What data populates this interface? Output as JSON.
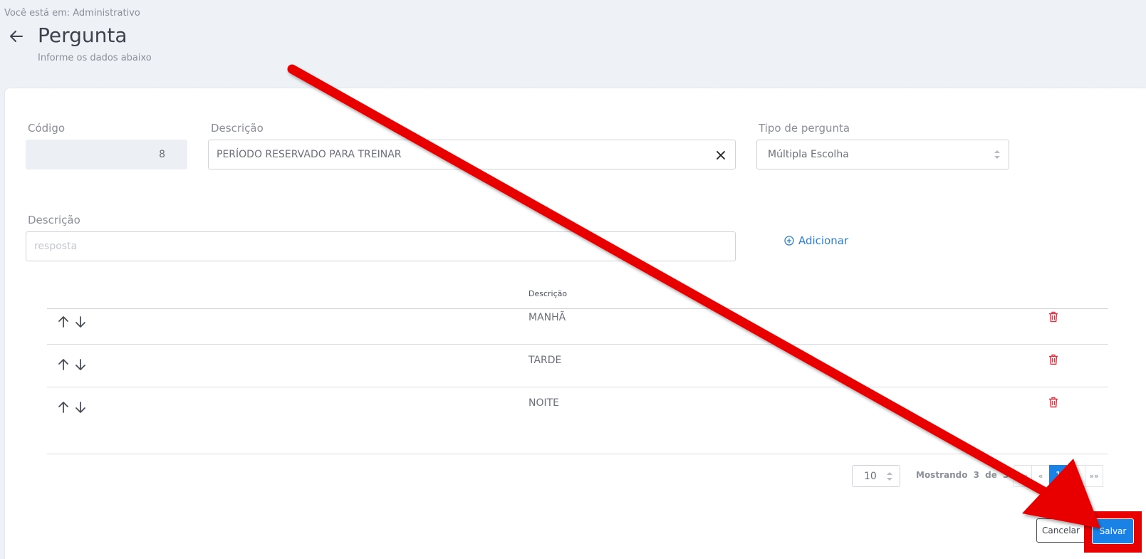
{
  "breadcrumb": "Você está em: Administrativo",
  "page": {
    "title": "Pergunta",
    "subtitle": "Informe os dados abaixo"
  },
  "form": {
    "codigo": {
      "label": "Código",
      "value": "8"
    },
    "descricao": {
      "label": "Descrição",
      "value": "PERÍODO RESERVADO PARA TREINAR"
    },
    "tipo": {
      "label": "Tipo de pergunta",
      "value": "Múltipla Escolha"
    },
    "resposta": {
      "label": "Descrição",
      "placeholder": "resposta"
    },
    "add_label": "Adicionar"
  },
  "table": {
    "header": "Descrição",
    "rows": [
      "MANHÃ",
      "TARDE",
      "NOITE"
    ]
  },
  "pagination": {
    "page_size": "10",
    "showing": "Mostrando 3 de 3",
    "first": "««",
    "prev": "«",
    "current": "1",
    "next": "»",
    "last": "»»"
  },
  "actions": {
    "cancel": "Cancelar",
    "save": "Salvar"
  },
  "colors": {
    "accent": "#1a82e6",
    "danger": "#dc3545",
    "annotation": "#e80000"
  }
}
